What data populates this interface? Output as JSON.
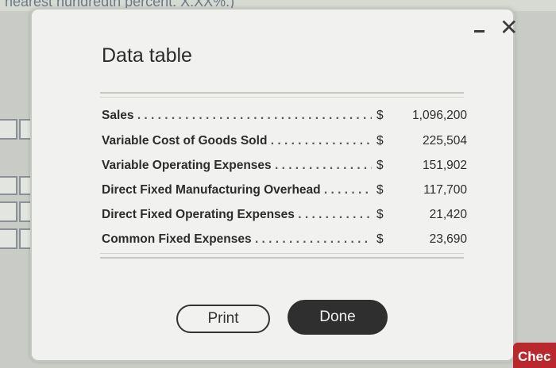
{
  "background": {
    "header_fragment": "nearest hundredth percent. X.XX%.)"
  },
  "modal": {
    "title": "Data table",
    "minimize_label": "-",
    "close_label": "✕",
    "rows": [
      {
        "label": "Sales",
        "dollar": "$",
        "amount": "1,096,200"
      },
      {
        "label": "Variable Cost of Goods Sold",
        "dollar": "$",
        "amount": "225,504"
      },
      {
        "label": "Variable Operating Expenses",
        "dollar": "$",
        "amount": "151,902"
      },
      {
        "label": "Direct Fixed Manufacturing Overhead",
        "dollar": "$",
        "amount": "117,700"
      },
      {
        "label": "Direct Fixed Operating Expenses",
        "dollar": "$",
        "amount": "21,420"
      },
      {
        "label": "Common Fixed Expenses",
        "dollar": "$",
        "amount": "23,690"
      }
    ],
    "print_label": "Print",
    "done_label": "Done"
  },
  "footer": {
    "check_label": "Chec"
  },
  "colors": {
    "done_button": "#2f2f2f",
    "check_button": "#b8282c"
  }
}
